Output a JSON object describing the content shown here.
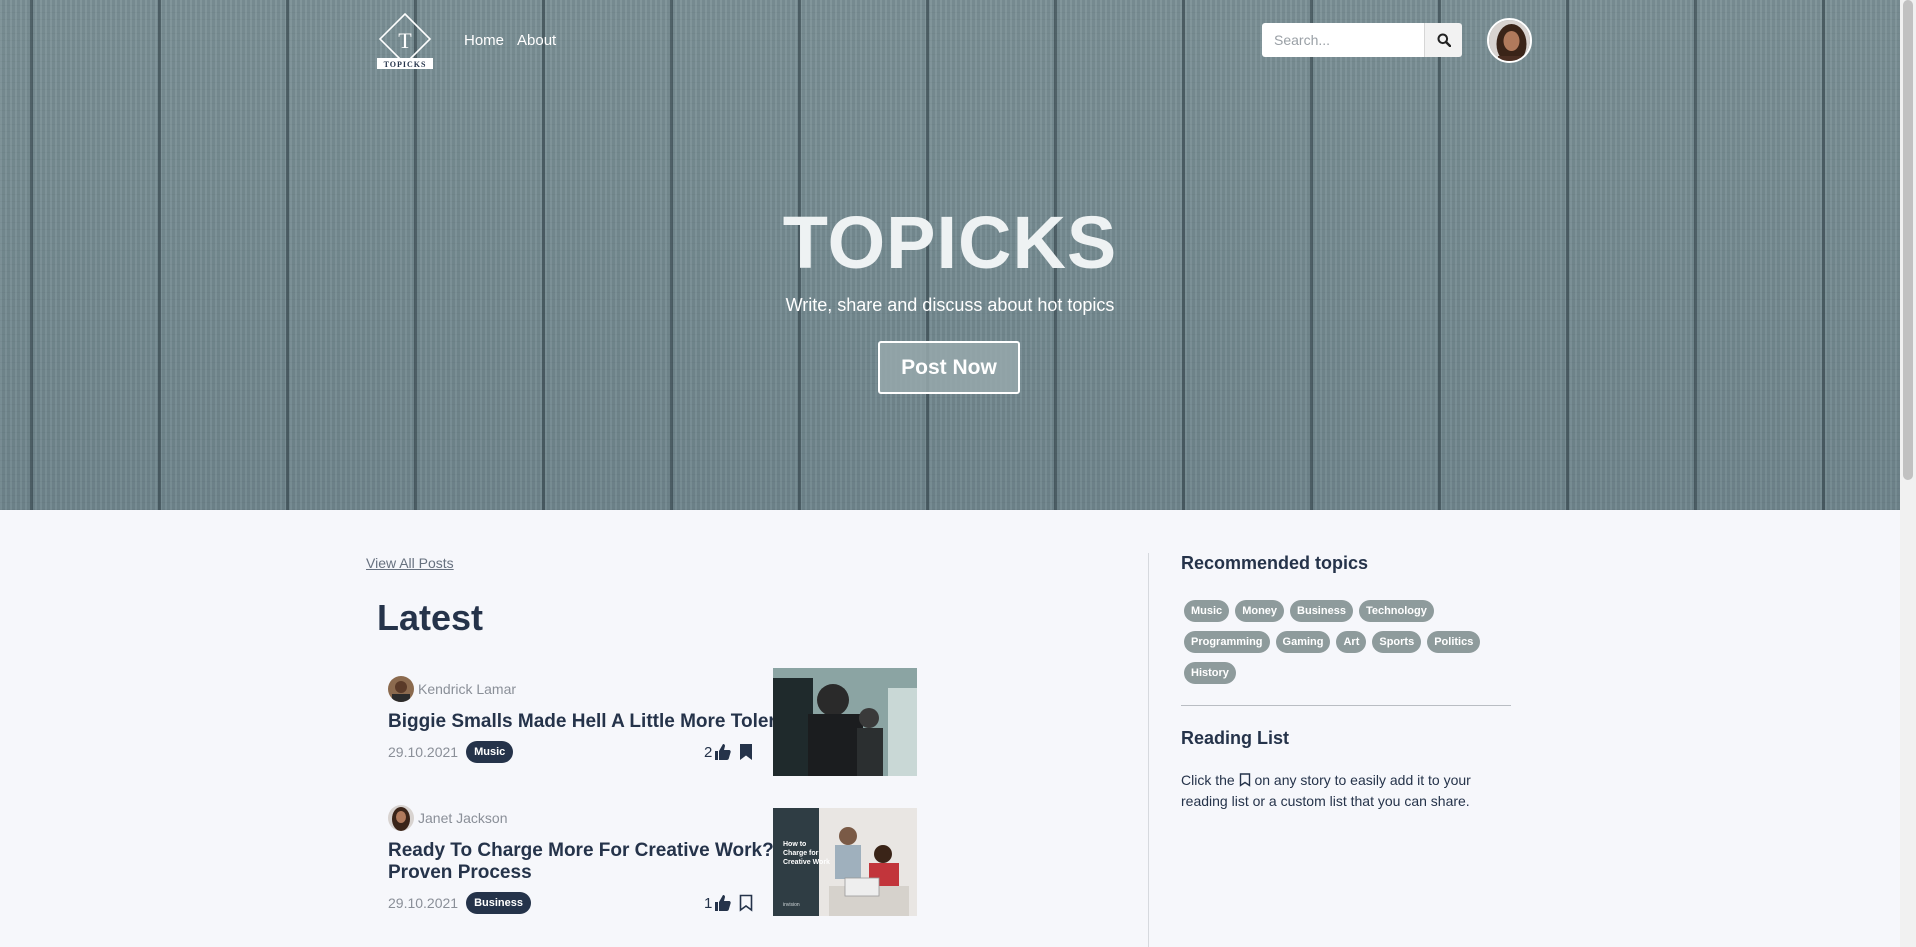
{
  "nav": {
    "logo_letter": "T",
    "logo_text": "TOPICKS",
    "links": [
      {
        "label": "Home"
      },
      {
        "label": "About"
      }
    ],
    "search_placeholder": "Search..."
  },
  "hero": {
    "title": "TOPICKS",
    "subtitle": "Write, share and discuss about hot topics",
    "button_label": "Post Now"
  },
  "main": {
    "view_all_label": "View All Posts",
    "section_title": "Latest",
    "posts": [
      {
        "author": "Kendrick Lamar",
        "title": "Biggie Smalls Made Hell A Little More Tolerable",
        "date": "29.10.2021",
        "tag": "Music",
        "likes": "2",
        "bookmarked": true
      },
      {
        "author": "Janet Jackson",
        "title": "Ready To Charge More For Creative Work? Follow This Proven Process",
        "date": "29.10.2021",
        "tag": "Business",
        "likes": "1",
        "bookmarked": false,
        "thumb_text": "How to Charge for Creative Work",
        "thumb_brand": "invision"
      }
    ]
  },
  "sidebar": {
    "recommended_title": "Recommended topics",
    "topics": [
      "Music",
      "Money",
      "Business",
      "Technology",
      "Programming",
      "Gaming",
      "Art",
      "Sports",
      "Politics",
      "History"
    ],
    "reading_title": "Reading List",
    "reading_text_before": "Click the",
    "reading_text_after": "on any story to easily add it to your reading list or a custom list that you can share."
  },
  "colors": {
    "primary": "#25334a",
    "tag_bg": "#8e9b9c",
    "page_bg": "#f6f7fb",
    "hero_bg": "#7e939a"
  },
  "icons": {
    "search": "search-icon",
    "like": "thumbs-up-icon",
    "bookmark": "bookmark-icon"
  }
}
